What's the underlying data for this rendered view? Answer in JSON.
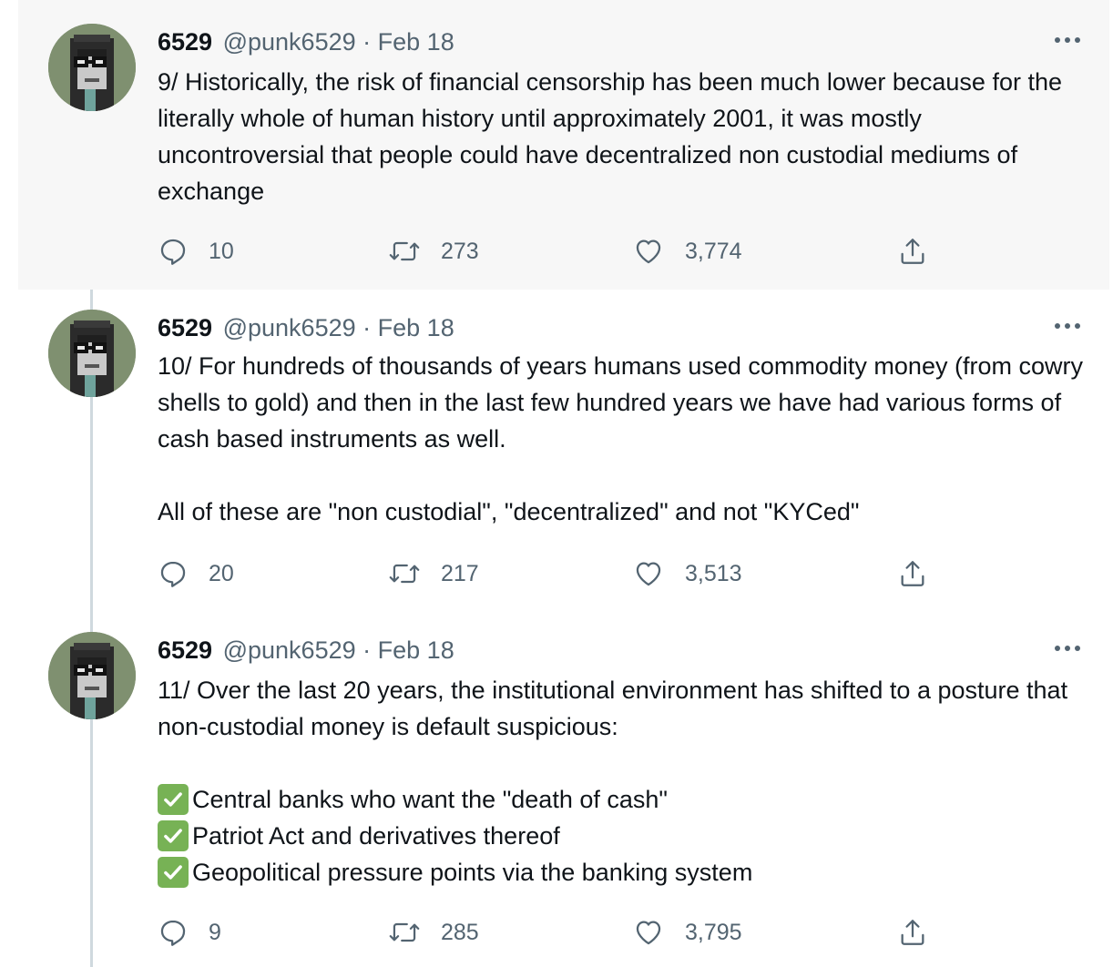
{
  "tweets": [
    {
      "name": "6529",
      "handle": "@punk6529",
      "separator": "·",
      "date": "Feb 18",
      "paragraphs": [
        "9/ Historically, the risk of financial censorship has been much lower because for the literally whole of human history until approximately 2001, it was mostly uncontroversial that people could have decentralized non custodial mediums of exchange"
      ],
      "replies": "10",
      "retweets": "273",
      "likes": "3,774"
    },
    {
      "name": "6529",
      "handle": "@punk6529",
      "separator": "·",
      "date": "Feb 18",
      "paragraphs": [
        "10/ For hundreds of thousands of years humans used commodity money (from cowry shells to gold) and then in the last few hundred years we have had various forms of cash based instruments as well.",
        "All of these are \"non custodial\", \"decentralized\" and not \"KYCed\""
      ],
      "replies": "20",
      "retweets": "217",
      "likes": "3,513"
    },
    {
      "name": "6529",
      "handle": "@punk6529",
      "separator": "·",
      "date": "Feb 18",
      "paragraphs": [
        "11/ Over the last 20 years, the institutional environment has shifted to a posture that non-custodial money is default suspicious:"
      ],
      "checklist": [
        "Central banks who want the \"death of cash\"",
        "Patriot Act and derivatives thereof",
        "Geopolitical pressure points via the banking system"
      ],
      "replies": "9",
      "retweets": "285",
      "likes": "3,795"
    }
  ],
  "icons": {
    "avatar": "pixel-punk-avatar-icon",
    "more": "more-options-icon",
    "reply": "reply-icon",
    "retweet": "retweet-icon",
    "like": "heart-icon",
    "share": "share-icon",
    "check": "check-mark-icon"
  },
  "colors": {
    "highlight_background": "#f7f7f7",
    "thread_line": "#cfd9de",
    "secondary_text": "#536471",
    "check_green": "#77b255"
  }
}
